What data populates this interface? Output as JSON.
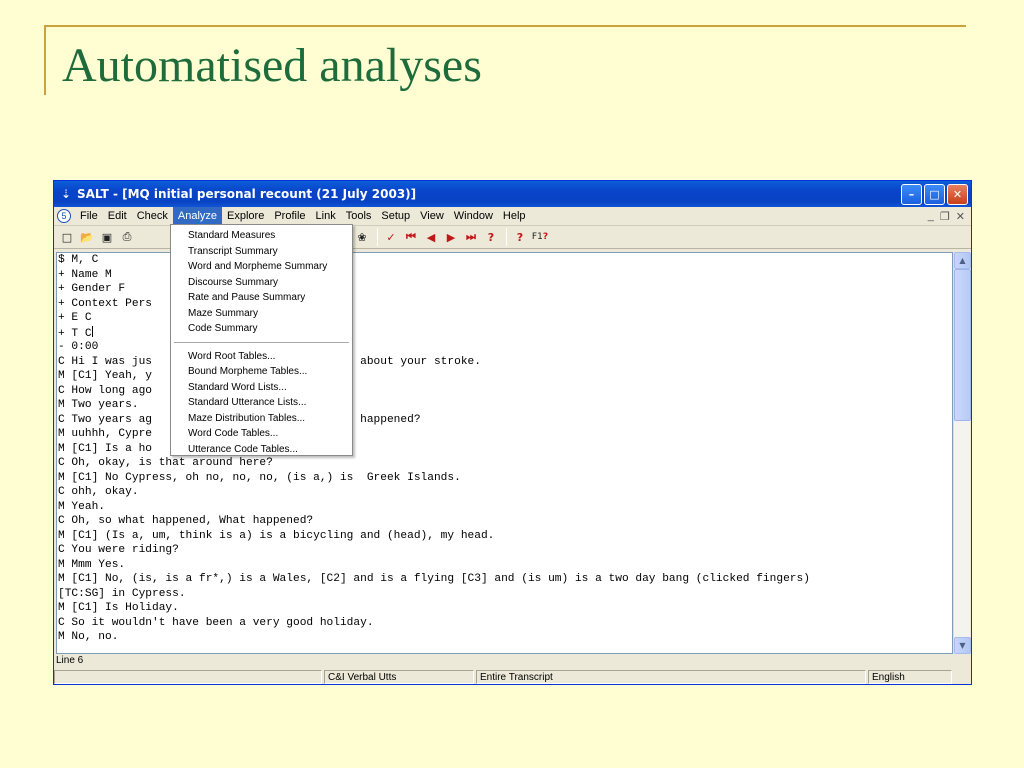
{
  "slide": {
    "title": "Automatised analyses"
  },
  "window": {
    "title": "SALT - [MQ initial personal recount (21 July 2003)]",
    "menu": [
      "File",
      "Edit",
      "Check",
      "Analyze",
      "Explore",
      "Profile",
      "Link",
      "Tools",
      "Setup",
      "View",
      "Window",
      "Help"
    ],
    "active_menu": "Analyze"
  },
  "analyze_menu": {
    "group1": [
      "Standard Measures",
      "Transcript Summary",
      "Word and Morpheme Summary",
      "Discourse Summary",
      "Rate and Pause Summary",
      "Maze Summary",
      "Code Summary"
    ],
    "group2": [
      "Word Root Tables...",
      "Bound Morpheme Tables...",
      "Standard Word Lists...",
      "Standard Utterance Lists...",
      "Maze Distribution Tables...",
      "Word Code Tables...",
      "Utterance Code Tables..."
    ]
  },
  "transcript": {
    "lines": [
      "$ M, C",
      "+ Name M",
      "+ Gender F",
      "+ Context Pers",
      "+ E C",
      "+ T C",
      "- 0:00",
      "C Hi I was jus                       estions about your stroke.",
      "M [C1] Yeah, y",
      "C How long ago",
      "M Two years.",
      "C Two years ag                      hen that happened?",
      "M uuhhh, Cypre",
      "M [C1] Is a ho",
      "C Oh, okay, is that around here?",
      "M [C1] No Cypress, oh no, no, no, (is a,) is  Greek Islands.",
      "C ohh, okay.",
      "M Yeah.",
      "C Oh, so what happened, What happened?",
      "M [C1] (Is a, um, think is a) is a bicycling and (head), my head.",
      "C You were riding?",
      "M Mmm Yes.",
      "M [C1] No, (is, is a fr*,) is a Wales, [C2] and is a flying [C3] and (is um) is a two day bang (clicked fingers)",
      "[TC:SG] in Cypress.",
      "M [C1] Is Holiday.",
      "C So it wouldn't have been a very good holiday.",
      "M No, no."
    ]
  },
  "status": {
    "line": "Line 6",
    "utt_type": "C&I Verbal Utts",
    "scope": "Entire Transcript",
    "language": "English"
  }
}
